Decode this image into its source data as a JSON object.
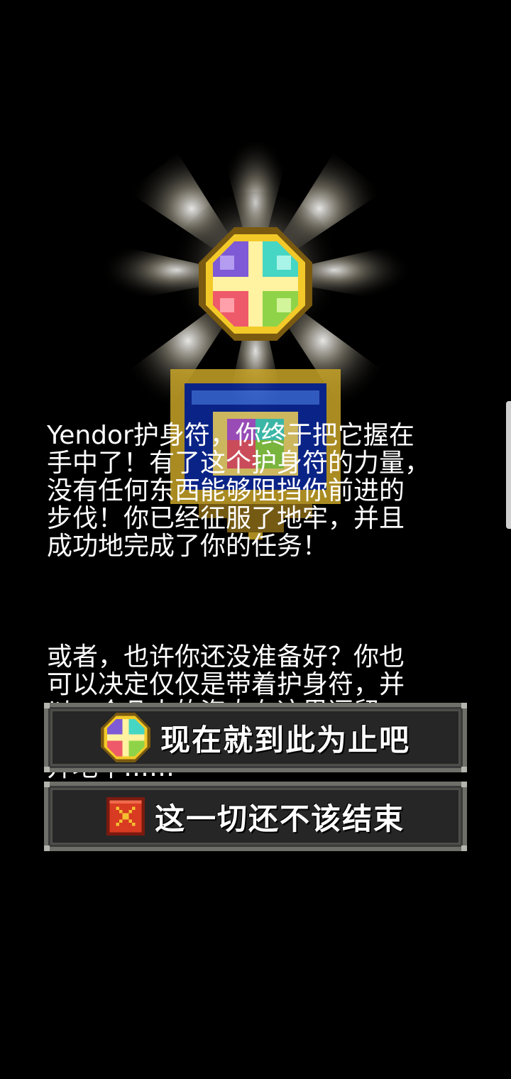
{
  "story": {
    "paragraph_1": "Yendor护身符，你终于把它握在\n手中了！有了这个护身符的力量，\n没有任何东西能够阻挡你前进的\n步伐！你已经征服了地牢，并且\n成功地完成了你的任务！",
    "paragraph_2": "或者，也许你还没准备好？你也\n可以决定仅仅是带着护身符，并\n以一个凡人的姿态在这里逗留一\n会，又或许以一种经典的方式离\n开地牢……"
  },
  "buttons": {
    "end_label": "现在就到此为止吧",
    "end_icon": "amulet-icon",
    "continue_label": "这一切还不该结束",
    "continue_icon": "red-x-icon"
  },
  "colors": {
    "background": "#000000",
    "text": "#ffffff",
    "button_bg": "#262626",
    "button_border": "#6f6f6a",
    "amulet_gold": "#f2c928",
    "close_red": "#d83a22"
  }
}
